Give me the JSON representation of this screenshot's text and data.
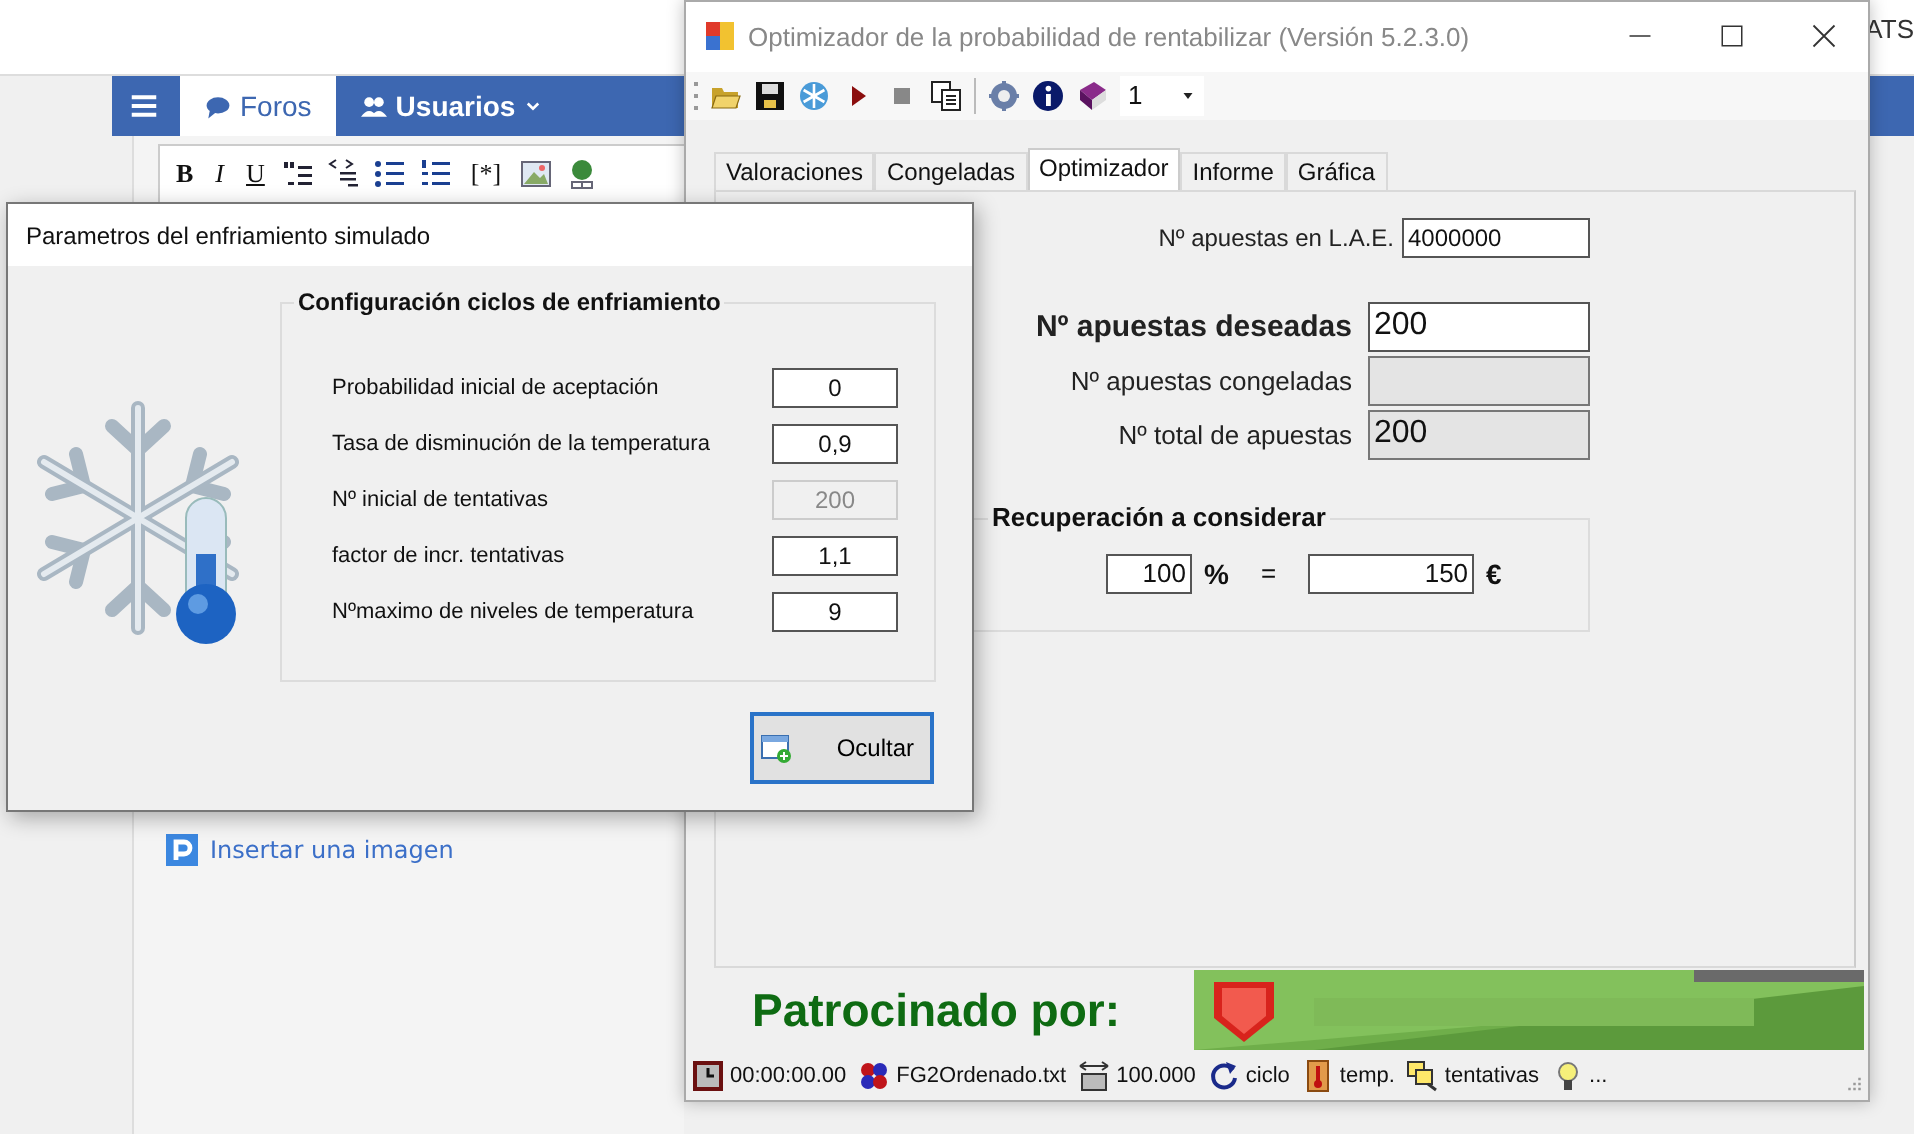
{
  "background_page": {
    "corner_text": "ATS",
    "nav": [
      {
        "label": "Foros",
        "selected": true,
        "dropdown": false
      },
      {
        "label": "Usuarios",
        "selected": false,
        "dropdown": true
      }
    ],
    "editor_buttons": [
      "B",
      "I",
      "U",
      "[*]"
    ],
    "insert_image_link": "Insertar una imagen"
  },
  "main_window": {
    "title": "Optimizador de la probabilidad de rentabilizar (Versión 5.2.3.0)",
    "combo": {
      "value": "1"
    },
    "tabs": [
      {
        "label": "Valoraciones",
        "selected": false
      },
      {
        "label": "Congeladas",
        "selected": false
      },
      {
        "label": "Optimizador",
        "selected": true
      },
      {
        "label": "Informe",
        "selected": false
      },
      {
        "label": "Gráfica",
        "selected": false
      }
    ],
    "top_field": {
      "label": "Nº apuestas en L.A.E.",
      "value": "4000000"
    },
    "fields": [
      {
        "label": "Nº apuestas deseadas",
        "value": "200",
        "bold": true,
        "readonly": false
      },
      {
        "label": "Nº apuestas congeladas",
        "readonly": true,
        "bold": false
      },
      {
        "label": "Nº total de apuestas",
        "value": "200",
        "readonly": true,
        "bold": false
      }
    ],
    "recovery": {
      "title": "Recuperación a considerar",
      "percent": "100",
      "percent_sign": "%",
      "equals": "=",
      "amount": "150",
      "currency": "€"
    },
    "sponsor": {
      "label": "Patrocinado por:"
    },
    "status_bar": [
      "00:00:00.00",
      "FG2Ordenado.txt",
      "100.000",
      "ciclo",
      "temp.",
      "tentativas",
      "..."
    ]
  },
  "dialog": {
    "title": "Parametros del enfriamiento simulado",
    "group_title": "Configuración ciclos de enfriamiento",
    "params": [
      {
        "label": "Probabilidad inicial de aceptación",
        "value": "0",
        "disabled": false
      },
      {
        "label": "Tasa de disminución de la temperatura",
        "value": "0,9",
        "disabled": false
      },
      {
        "label": "Nº inicial de tentativas",
        "value": "200",
        "disabled": true
      },
      {
        "label": "factor de incr. tentativas",
        "value": "1,1",
        "disabled": false
      },
      {
        "label": "Nºmaximo de niveles de temperatura",
        "value": "9",
        "disabled": false
      }
    ],
    "button": "Ocultar"
  }
}
